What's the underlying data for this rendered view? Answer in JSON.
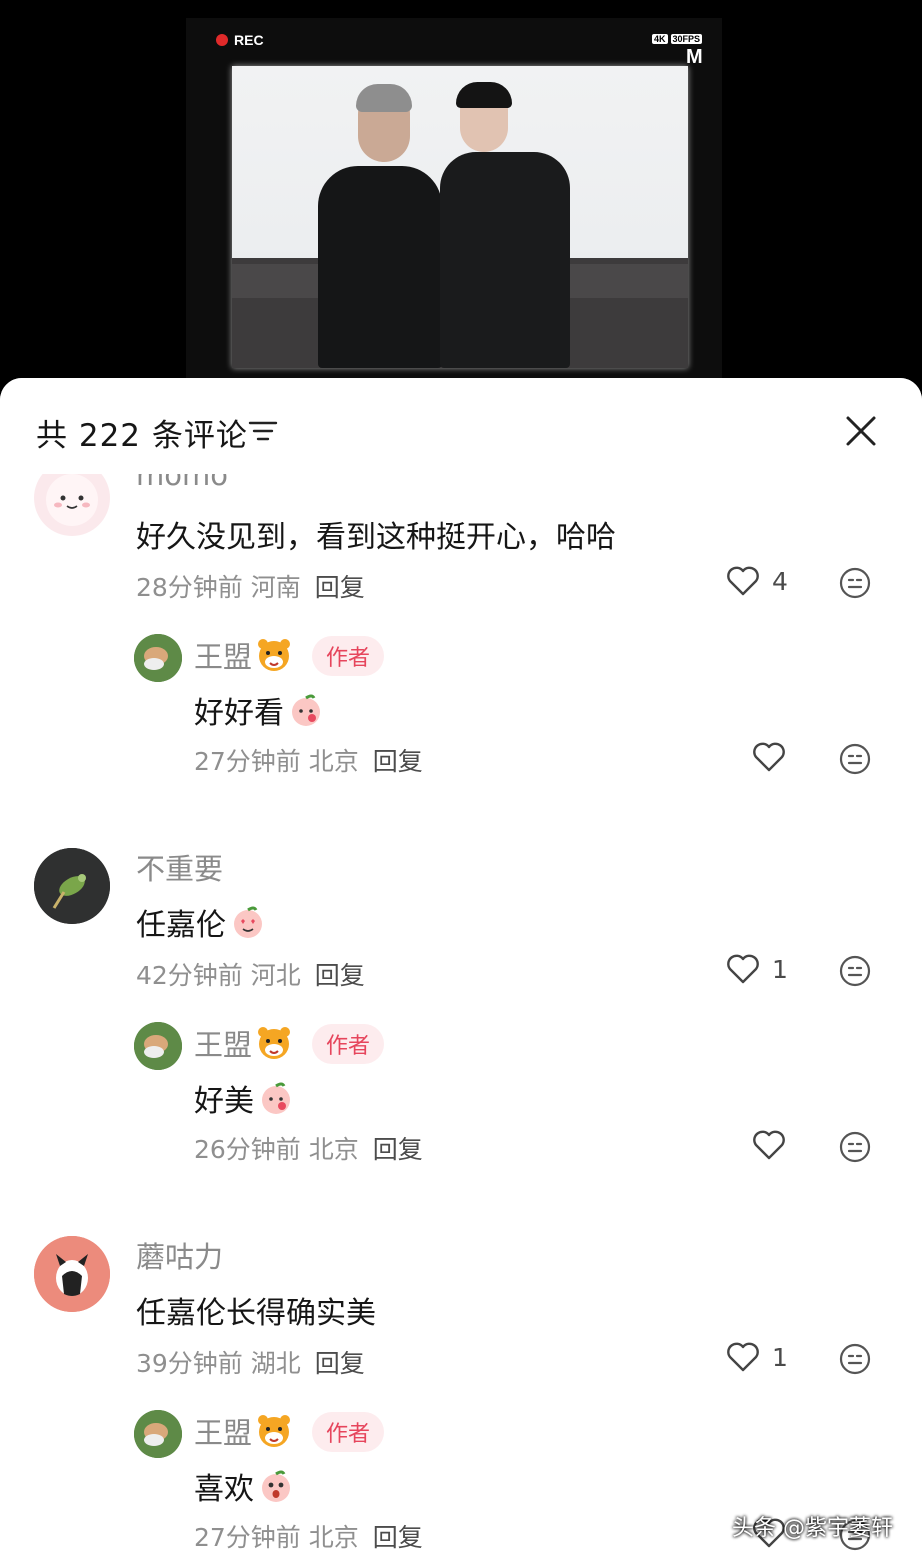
{
  "video": {
    "rec_label": "REC",
    "badge_4k": "4K",
    "badge_fps": "30FPS",
    "corner_logo": "M"
  },
  "sheet": {
    "title": "共 222 条评论",
    "filter_icon": "filter-lines-icon",
    "close_icon": "close-x-icon"
  },
  "comments": [
    {
      "username": "momo",
      "text": "好久没见到，看到这种挺开心，哈哈",
      "time": "28分钟前",
      "location": "河南",
      "reply": "回复",
      "likes": "4",
      "reply_item": {
        "username": "王盟",
        "author_tag": "作者",
        "text": "好好看",
        "time": "27分钟前",
        "location": "北京",
        "reply": "回复"
      }
    },
    {
      "username": "不重要",
      "text": "任嘉伦",
      "time": "42分钟前",
      "location": "河北",
      "reply": "回复",
      "likes": "1",
      "reply_item": {
        "username": "王盟",
        "author_tag": "作者",
        "text": "好美",
        "time": "26分钟前",
        "location": "北京",
        "reply": "回复"
      }
    },
    {
      "username": "蘑咕力",
      "text": "任嘉伦长得确实美",
      "time": "39分钟前",
      "location": "湖北",
      "reply": "回复",
      "likes": "1",
      "reply_item": {
        "username": "王盟",
        "author_tag": "作者",
        "text": "喜欢",
        "time": "27分钟前",
        "location": "北京",
        "reply": "回复"
      }
    }
  ],
  "watermark": "头条 @紫宇萎轩",
  "colors": {
    "author_tag_bg": "#fdecee",
    "author_tag_text": "#e6455c",
    "meta_gray": "#8f8f8f"
  }
}
